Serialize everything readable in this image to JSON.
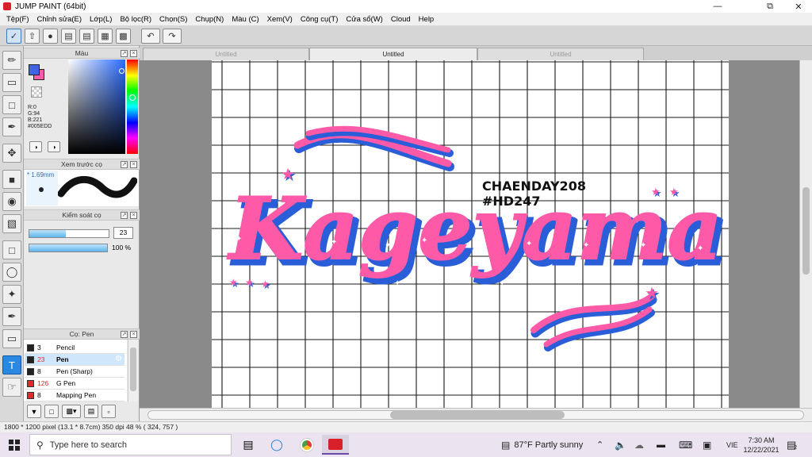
{
  "window": {
    "title": "JUMP PAINT (64bit)",
    "controls": [
      "minimize-icon",
      "restore-icon",
      "close-icon"
    ]
  },
  "menu": [
    "Tệp(F)",
    "Chỉnh sửa(E)",
    "Lớp(L)",
    "Bộ lọc(R)",
    "Chọn(S)",
    "Chụp(N)",
    "Màu (C)",
    "Xem(V)",
    "Công cụ(T)",
    "Cửa sổ(W)",
    "Cloud",
    "Help"
  ],
  "toolbar": {
    "buttons": [
      "toggle-icon",
      "export-icon",
      "chat-icon",
      "comment-icon",
      "page-icon",
      "properties-icon",
      "grid-properties-icon",
      "undo-icon",
      "redo-icon"
    ]
  },
  "tools": [
    "brush-icon",
    "eraser-icon",
    "selection-rect-icon",
    "pen-tool-icon",
    "move-icon",
    "fill-rect-icon",
    "bucket-icon",
    "gradient-icon",
    "marquee-icon",
    "lasso-icon",
    "magic-wand-icon",
    "select-pen-icon",
    "select-eraser-icon",
    "text-icon",
    "hand-icon"
  ],
  "color_panel": {
    "title": "Màu",
    "r": "R:0",
    "g": "G:94",
    "b": "B:221",
    "hex": "#005EDD",
    "fg_color": "#005EDD",
    "bg_color": "#FF5AA8"
  },
  "brush_preview": {
    "title": "Xem trước cọ",
    "size": "* 1.69mm"
  },
  "brush_control": {
    "title": "Kiểm soát cọ",
    "size_value": "23",
    "size_fraction": 0.46,
    "opacity_value": "100 %",
    "opacity_fraction": 1.0
  },
  "brush_list": {
    "title": "Cọ: Pen",
    "items": [
      {
        "size": "3",
        "name": "Pencil",
        "color": "#222222",
        "selected": false
      },
      {
        "size": "23",
        "name": "Pen",
        "color": "#222222",
        "selected": true
      },
      {
        "size": "8",
        "name": "Pen (Sharp)",
        "color": "#222222",
        "selected": false
      },
      {
        "size": "126",
        "name": "G Pen",
        "color": "#e02a2a",
        "selected": false
      },
      {
        "size": "8",
        "name": "Mapping Pen",
        "color": "#e02a2a",
        "selected": false
      }
    ]
  },
  "tabs": [
    "Untitled",
    "Untitled",
    "Untitled"
  ],
  "active_tab": 1,
  "artwork": {
    "main_text": "Kageyama",
    "credit_line1": "CHAENDAY208",
    "credit_line2": "#HD247",
    "pink": "#ff5aa8",
    "blue": "#2a5ed8"
  },
  "status": {
    "text": "1800 * 1200 pixel  (13.1 * 8.7cm)  350 dpi  48 %  ( 324, 757 )"
  },
  "taskbar": {
    "search_placeholder": "Type here to search",
    "weather": "87°F  Partly sunny",
    "lang": "VIE",
    "time": "7:30 AM",
    "date": "12/22/2021",
    "notification_count": "2"
  }
}
